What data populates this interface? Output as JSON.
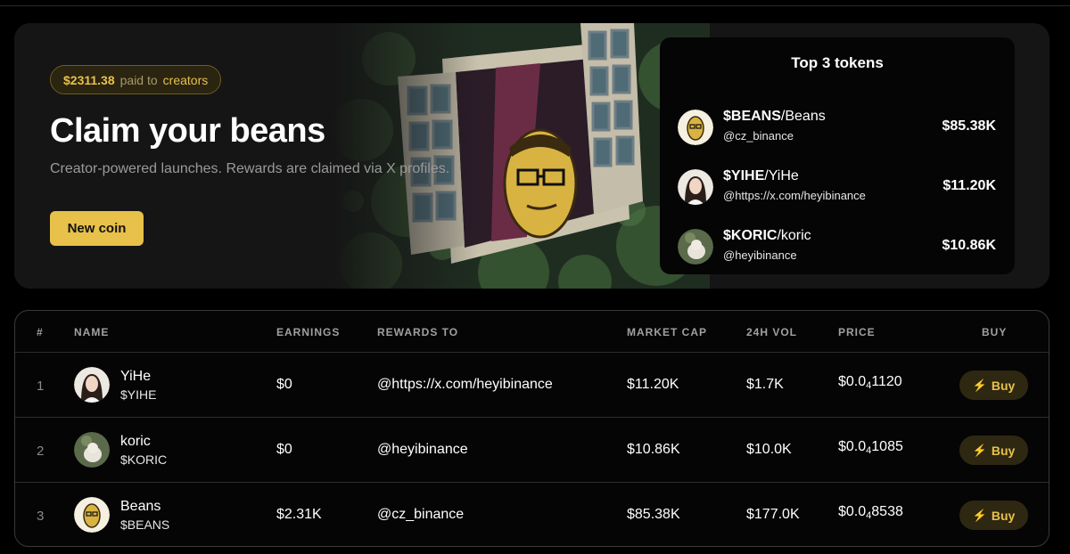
{
  "hero": {
    "paid_amount": "$2311.38",
    "paid_text": "paid to",
    "paid_link": "creators",
    "title": "Claim your beans",
    "subtitle": "Creator-powered launches. Rewards are claimed via X profiles.",
    "new_coin_label": "New coin"
  },
  "top3": {
    "title": "Top 3 tokens",
    "items": [
      {
        "symbol": "$BEANS",
        "name": "/Beans",
        "handle": "@cz_binance",
        "value": "$85.38K",
        "avatar": "bean-avatar"
      },
      {
        "symbol": "$YIHE",
        "name": "/YiHe",
        "handle": "@https://x.com/heyibinance",
        "value": "$11.20K",
        "avatar": "person-avatar"
      },
      {
        "symbol": "$KORIC",
        "name": "/koric",
        "handle": "@heyibinance",
        "value": "$10.86K",
        "avatar": "dog-avatar"
      }
    ]
  },
  "table": {
    "headers": {
      "num": "#",
      "name": "NAME",
      "earnings": "EARNINGS",
      "rewards": "REWARDS TO",
      "mcap": "MARKET CAP",
      "vol": "24H VOL",
      "price": "PRICE",
      "buy": "BUY"
    },
    "rows": [
      {
        "idx": "1",
        "name": "YiHe",
        "symbol": "$YIHE",
        "earnings": "$0",
        "rewards_to": "@https://x.com/heyibinance",
        "market_cap": "$11.20K",
        "vol": "$1.7K",
        "price_prefix": "$0.0",
        "price_zeros": "4",
        "price_digits": "1120",
        "buy": "Buy"
      },
      {
        "idx": "2",
        "name": "koric",
        "symbol": "$KORIC",
        "earnings": "$0",
        "rewards_to": "@heyibinance",
        "market_cap": "$10.86K",
        "vol": "$10.0K",
        "price_prefix": "$0.0",
        "price_zeros": "4",
        "price_digits": "1085",
        "buy": "Buy"
      },
      {
        "idx": "3",
        "name": "Beans",
        "symbol": "$BEANS",
        "earnings": "$2.31K",
        "rewards_to": "@cz_binance",
        "market_cap": "$85.38K",
        "vol": "$177.0K",
        "price_prefix": "$0.0",
        "price_zeros": "4",
        "price_digits": "8538",
        "buy": "Buy"
      }
    ]
  },
  "colors": {
    "accent": "#e8c14a",
    "panel": "#151515",
    "background": "#000000"
  }
}
